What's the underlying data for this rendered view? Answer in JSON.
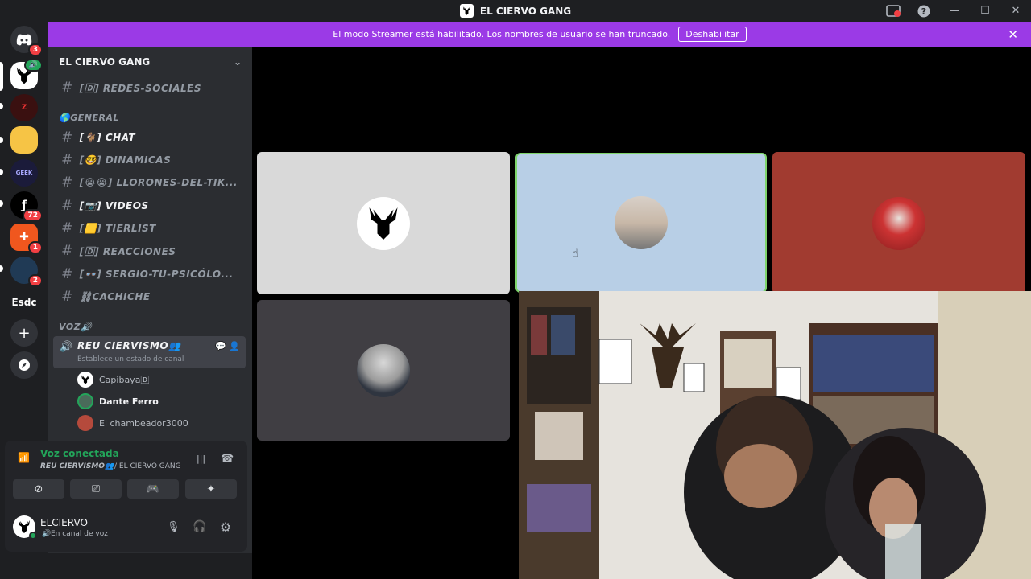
{
  "window": {
    "title": "EL CIERVO GANG"
  },
  "banner": {
    "text": "El modo Streamer está habilitado. Los nombres de usuario se han truncado.",
    "button": "Deshabilitar"
  },
  "rail": {
    "badges": {
      "discord": "3",
      "fa": "72",
      "fire": "1",
      "last": "2"
    },
    "text_server": "Esdc"
  },
  "guild": {
    "name": "EL CIERVO GANG"
  },
  "channels": {
    "redes": "[🄳] REDES-SOCIALES",
    "cat_general": "🌎GENERAL",
    "chat": "[🐐] CHAT",
    "dinamicas": "[🤓] DINAMICAS",
    "llorones": "[😭😭] LLORONES-DEL-TIK...",
    "videos": "[📷] VIDEOS",
    "tierlist": "[🟨] TIERLIST",
    "reacciones": "[🄳] REACCIONES",
    "sergio": "[👓] SERGIO-TU-PSICÓLO...",
    "cachiche": "⛓CACHICHE",
    "cat_voz": "VOZ🔊"
  },
  "voice_channel": {
    "name": "REU CIERVISMO👥",
    "status": "Establece un estado de canal"
  },
  "members": [
    "Capibaya🄳",
    "Dante Ferro",
    "El chambeador3000"
  ],
  "voice_panel": {
    "title": "Voz conectada",
    "location_channel": "REU CIERVISMO👥",
    "location_server": "/ EL CIERVO GANG"
  },
  "user": {
    "name": "ELCIERVO",
    "status": "En canal de voz"
  },
  "colors": {
    "accent": "#9b3ae6",
    "connected": "#23a55a",
    "tile2_border": "#7ed46b"
  }
}
